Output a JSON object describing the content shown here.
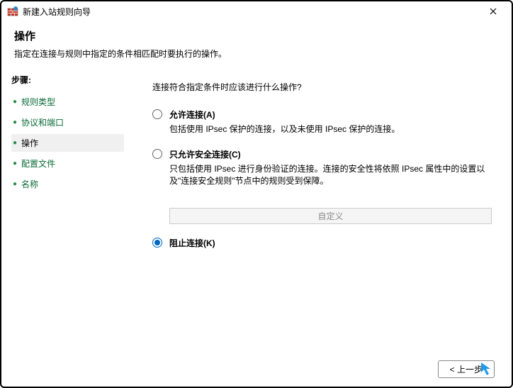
{
  "window": {
    "title": "新建入站规则向导"
  },
  "header": {
    "title": "操作",
    "subtitle": "指定在连接与规则中指定的条件相匹配时要执行的操作。"
  },
  "sidebar": {
    "stepsLabel": "步骤:",
    "items": [
      {
        "label": "规则类型"
      },
      {
        "label": "协议和端口"
      },
      {
        "label": "操作"
      },
      {
        "label": "配置文件"
      },
      {
        "label": "名称"
      }
    ]
  },
  "main": {
    "question": "连接符合指定条件时应该进行什么操作?",
    "options": [
      {
        "id": "allow",
        "label": "允许连接(A)",
        "desc": "包括使用 IPsec 保护的连接，以及未使用 IPsec 保护的连接。"
      },
      {
        "id": "allow-secure",
        "label": "只允许安全连接(C)",
        "desc": "只包括使用 IPsec 进行身份验证的连接。连接的安全性将依照 IPsec 属性中的设置以及\"连接安全规则\"节点中的规则受到保障。"
      },
      {
        "id": "block",
        "label": "阻止连接(K)",
        "desc": ""
      }
    ],
    "selected": "block",
    "customizeLabel": "自定义"
  },
  "footer": {
    "back": "< 上一步"
  }
}
